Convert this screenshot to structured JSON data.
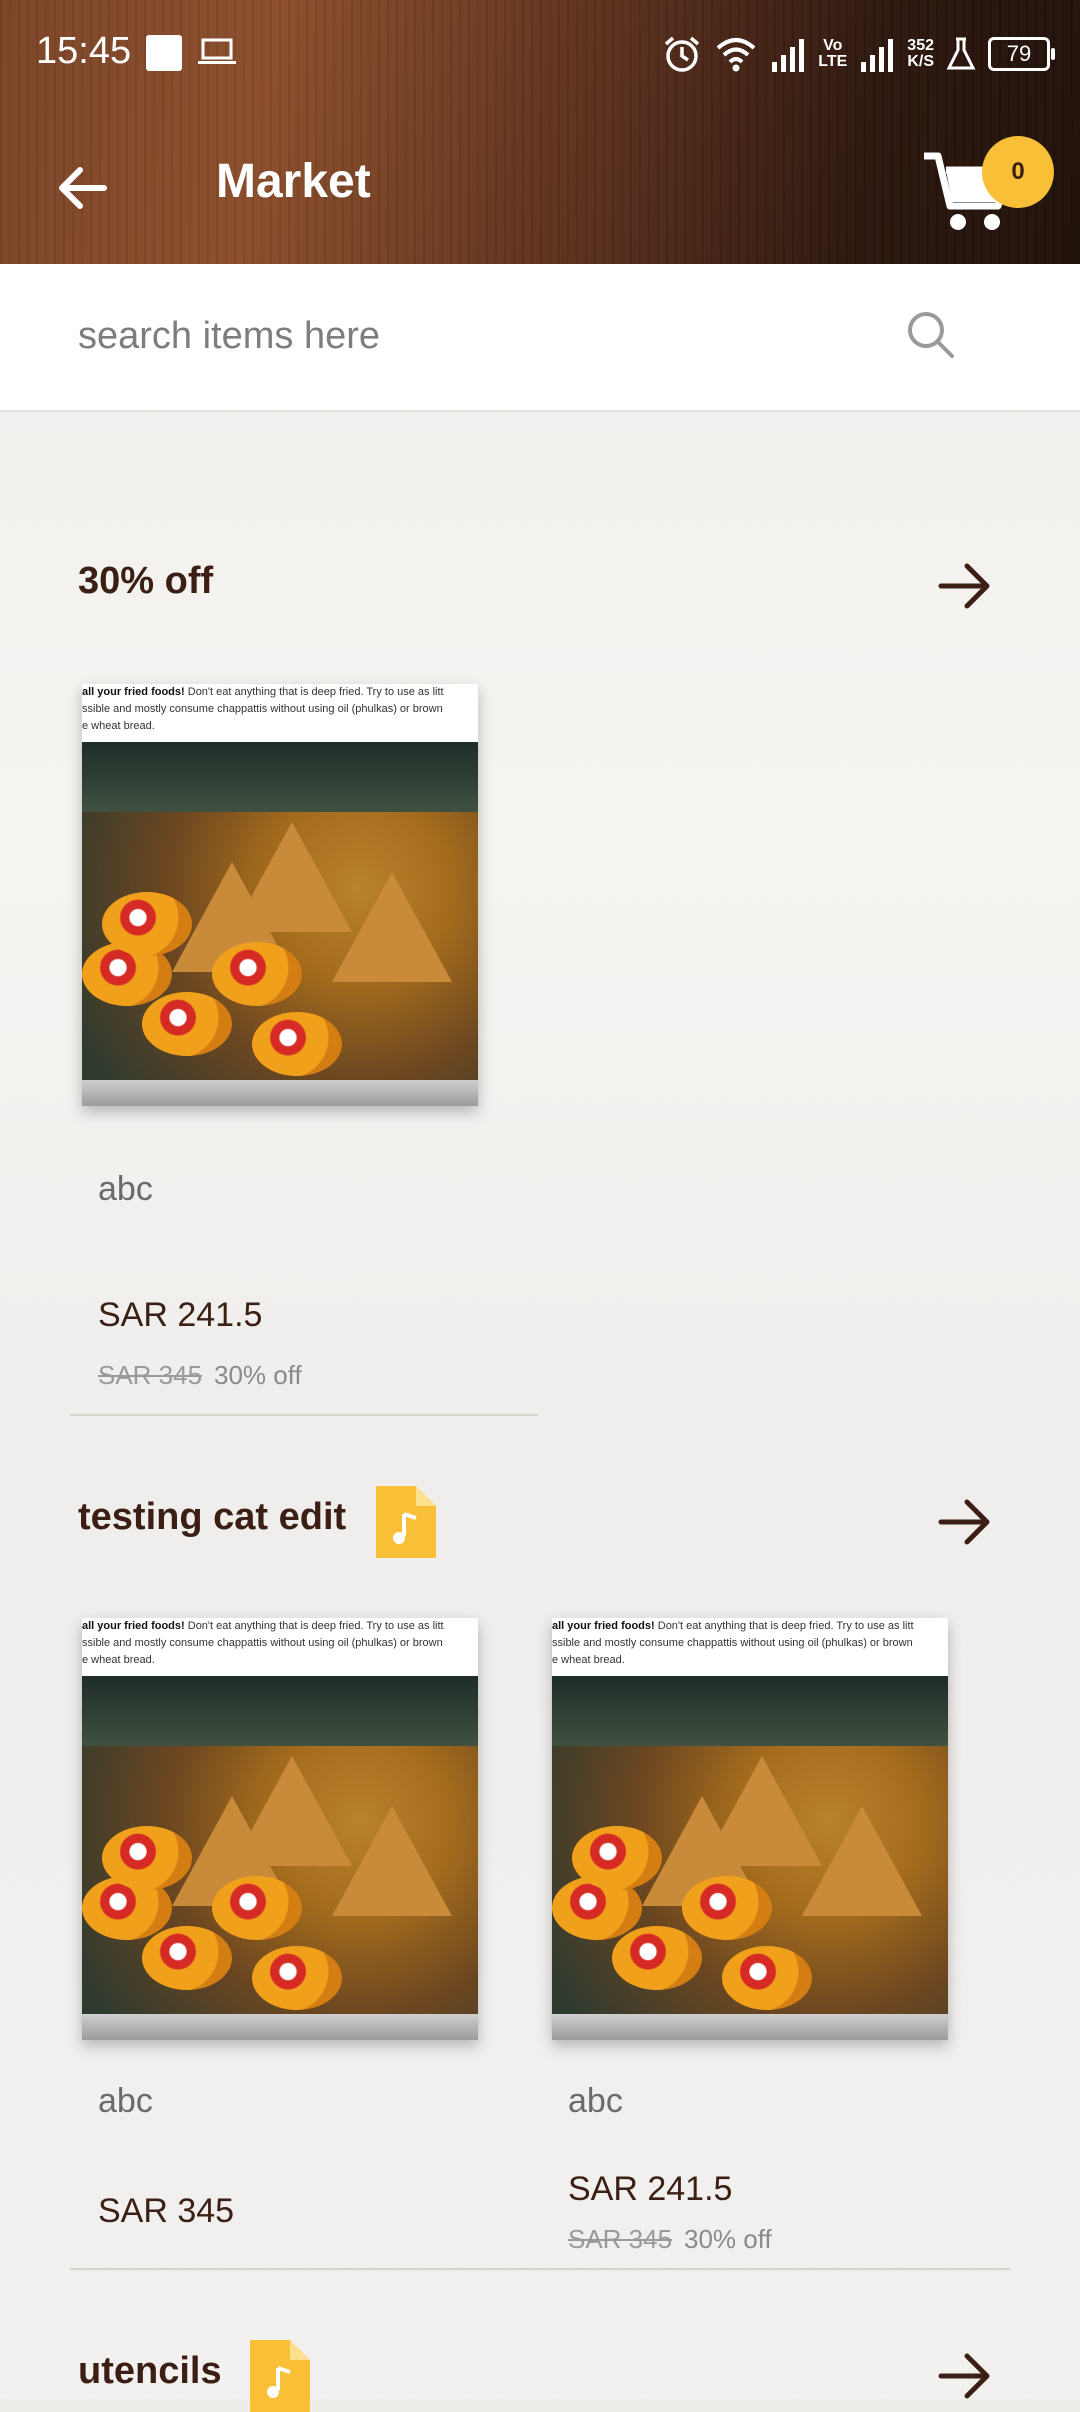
{
  "status_bar": {
    "time": "15:45",
    "net_speed_top": "352",
    "net_speed_bottom": "K/S",
    "volte_top": "Vo",
    "volte_bottom": "LTE",
    "battery": "79"
  },
  "header": {
    "title": "Market",
    "cart_count": "0"
  },
  "search": {
    "placeholder": "search items here"
  },
  "sections": [
    {
      "title": "30% off",
      "items": [
        {
          "image_caption_bold": "all your fried foods!",
          "image_caption_line1": " Don't eat anything that is deep fried. Try to use as litt",
          "image_caption_line2": "ssible and mostly consume chappattis without using oil (phulkas) or brown",
          "image_caption_line3": "e wheat bread.",
          "name": "abc",
          "price": "SAR 241.5",
          "old_price": "SAR 345",
          "discount": "30% off"
        }
      ]
    },
    {
      "title": "testing cat edit",
      "items": [
        {
          "image_caption_bold": "all your fried foods!",
          "image_caption_line1": " Don't eat anything that is deep fried. Try to use as litt",
          "image_caption_line2": "ssible and mostly consume chappattis without using oil (phulkas) or brown",
          "image_caption_line3": "e wheat bread.",
          "name": "abc",
          "price": "SAR 345"
        },
        {
          "image_caption_bold": "all your fried foods!",
          "image_caption_line1": " Don't eat anything that is deep fried. Try to use as litt",
          "image_caption_line2": "ssible and mostly consume chappattis without using oil (phulkas) or brown",
          "image_caption_line3": "e wheat bread.",
          "name": "abc",
          "price": "SAR 241.5",
          "old_price": "SAR 345",
          "discount": "30% off"
        }
      ]
    },
    {
      "title": "utencils"
    }
  ],
  "colors": {
    "accent": "#f8bf37",
    "brand_dark": "#3b1f14"
  }
}
